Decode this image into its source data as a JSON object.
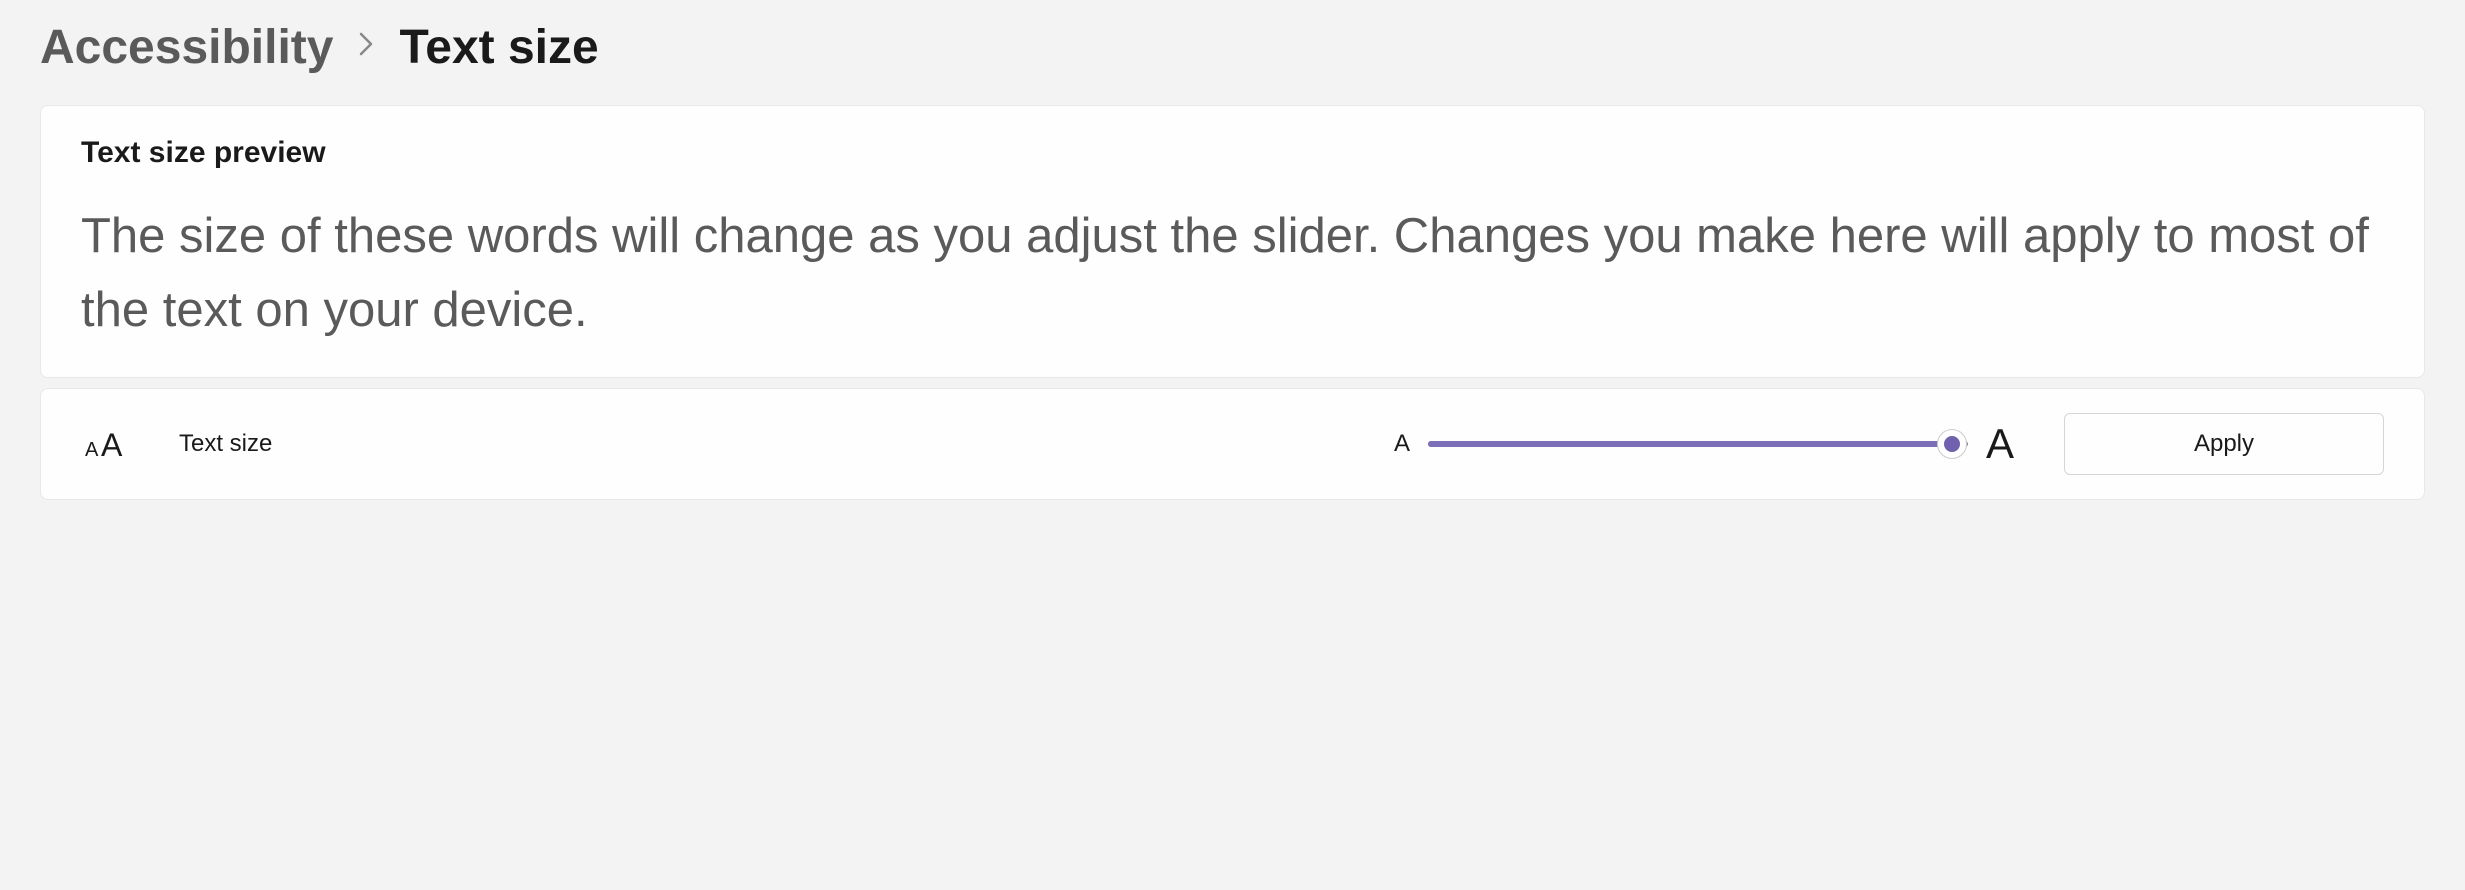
{
  "breadcrumb": {
    "parent": "Accessibility",
    "current": "Text size"
  },
  "preview": {
    "title": "Text size preview",
    "text": "The size of these words will change as you adjust the slider. Changes you make here will apply to most of the text on your device."
  },
  "control": {
    "label": "Text size",
    "slider_min_label": "A",
    "slider_max_label": "A",
    "apply_label": "Apply",
    "accent_color": "#7c6fb8"
  }
}
